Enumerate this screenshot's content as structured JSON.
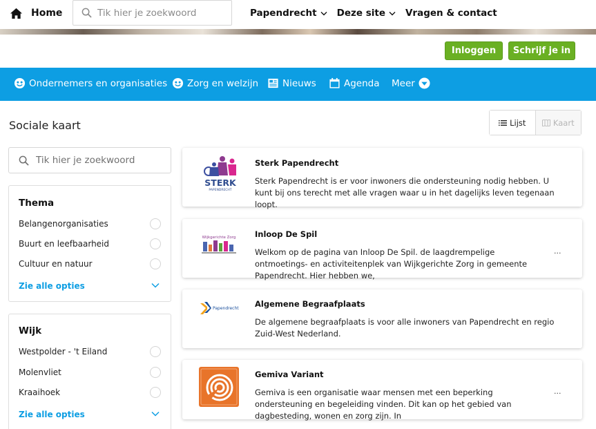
{
  "topbar": {
    "home_label": "Home",
    "search_placeholder": "Tik hier je zoekwoord",
    "nav": [
      {
        "label": "Papendrecht",
        "dropdown": true
      },
      {
        "label": "Deze site",
        "dropdown": true
      },
      {
        "label": "Vragen & contact",
        "dropdown": false
      }
    ]
  },
  "account": {
    "login_label": "Inloggen",
    "signup_label": "Schrijf je in"
  },
  "menu": {
    "items": [
      {
        "label": "Ondernemers en organisaties",
        "icon": "smiley-icon"
      },
      {
        "label": "Zorg en welzijn",
        "icon": "smiley-icon"
      },
      {
        "label": "Nieuws",
        "icon": "newspaper-icon"
      },
      {
        "label": "Agenda",
        "icon": "calendar-icon"
      },
      {
        "label": "Meer",
        "icon": "chevron-down-circle-icon"
      }
    ]
  },
  "page": {
    "title": "Sociale kaart",
    "view_list": "Lijst",
    "view_map": "Kaart"
  },
  "sidebar": {
    "search_placeholder": "Tik hier je zoekwoord",
    "thema": {
      "title": "Thema",
      "options": [
        "Belangenorganisaties",
        "Buurt en leefbaarheid",
        "Cultuur en natuur"
      ],
      "more": "Zie alle opties"
    },
    "wijk": {
      "title": "Wijk",
      "options": [
        "Westpolder - 't Eiland",
        "Molenvliet",
        "Kraaihoek"
      ],
      "more": "Zie alle opties"
    }
  },
  "results": [
    {
      "title": "Sterk Papendrecht",
      "description": "Sterk Papendrecht is er voor inwoners die ondersteuning nodig hebben. U kunt bij ons terecht met alle vragen waar u in het dagelijks leven tegenaan loopt.",
      "logo_text": "STERK",
      "logo_subtext": "PAPENDRECHT"
    },
    {
      "title": "Inloop De Spil",
      "description": "Welkom op de pagina van Inloop De Spil. de laagdrempelige ontmoetings- en activiteitenplek van Wijkgerichte Zorg in gemeente Papendrecht. Hier hebben we,",
      "logo_text": "Wijkgerichte Zorg",
      "ellipsis": "..."
    },
    {
      "title": "Algemene Begraafplaats",
      "description": "De algemene begraafplaats is voor alle inwoners van Papendrecht en regio Zuid-West Nederland.",
      "logo_text": "Papendrecht"
    },
    {
      "title": "Gemiva Variant",
      "description": "Gemiva is een organisatie waar mensen met een beperking ondersteuning en begeleiding vinden. Dit kan op het gebied van dagbesteding, wonen en zorg zijn. In",
      "ellipsis": "..."
    }
  ],
  "colors": {
    "brand_blue": "#0d9ee3",
    "green": "#6ab023"
  }
}
